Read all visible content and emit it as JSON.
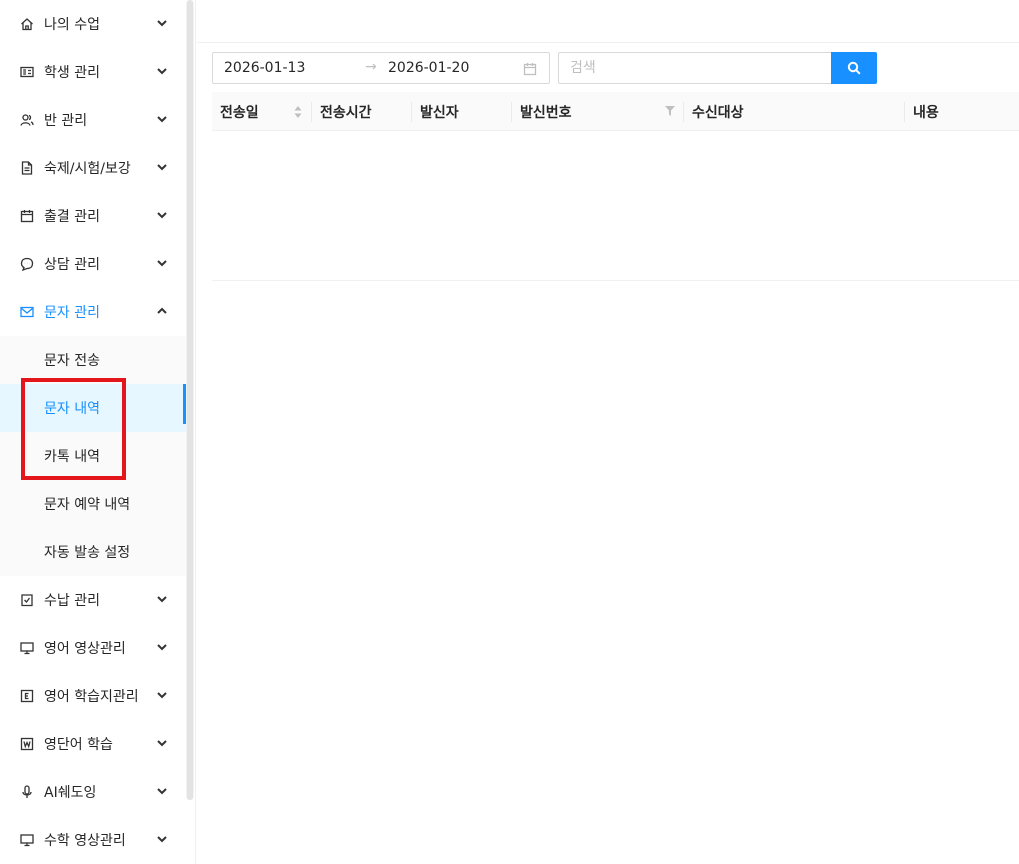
{
  "sidebar": {
    "menu_top": [
      {
        "label": "나의 수업",
        "icon": "home-icon"
      },
      {
        "label": "학생 관리",
        "icon": "id-card-icon"
      },
      {
        "label": "반 관리",
        "icon": "users-icon"
      },
      {
        "label": "숙제/시험/보강",
        "icon": "file-icon"
      },
      {
        "label": "출결 관리",
        "icon": "calendar-icon"
      },
      {
        "label": "상담 관리",
        "icon": "chat-icon"
      }
    ],
    "open_menu": {
      "label": "문자 관리",
      "icon": "mail-icon"
    },
    "submenu": [
      {
        "label": "문자 전송",
        "active": false
      },
      {
        "label": "문자 내역",
        "active": true
      },
      {
        "label": "카톡 내역",
        "active": false
      },
      {
        "label": "문자 예약 내역",
        "active": false
      },
      {
        "label": "자동 발송 설정",
        "active": false
      }
    ],
    "menu_bottom": [
      {
        "label": "수납 관리",
        "icon": "receipt-icon"
      },
      {
        "label": "영어 영상관리",
        "icon": "monitor-icon"
      },
      {
        "label": "영어 학습지관리",
        "icon": "letter-e-icon"
      },
      {
        "label": "영단어 학습",
        "icon": "letter-w-icon"
      },
      {
        "label": "AI쉐도잉",
        "icon": "microphone-icon"
      },
      {
        "label": "수학 영상관리",
        "icon": "monitor-icon"
      }
    ]
  },
  "filters": {
    "start_date": "2026-01-13",
    "end_date": "2026-01-20",
    "range_separator": "→",
    "search_placeholder": "검색",
    "search_value": ""
  },
  "table": {
    "columns": [
      {
        "label": "전송일",
        "sortable": true
      },
      {
        "label": "전송시간"
      },
      {
        "label": "발신자"
      },
      {
        "label": "발신번호",
        "filterable": true
      },
      {
        "label": "수신대상"
      },
      {
        "label": "내용"
      }
    ],
    "rows": []
  },
  "colors": {
    "accent": "#1890ff",
    "highlight": "#e3161b"
  }
}
